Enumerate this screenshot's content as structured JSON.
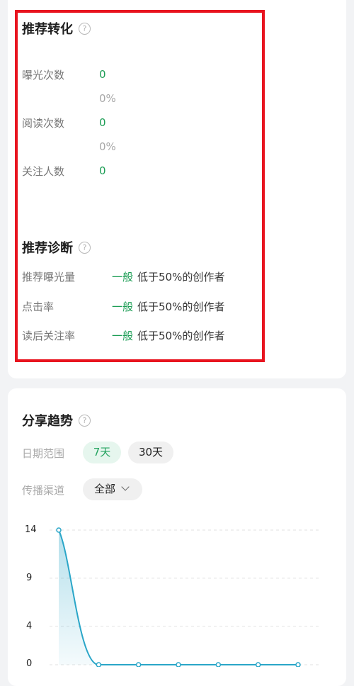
{
  "recommend_conversion": {
    "title": "推荐转化",
    "help_icon": "question-circle-icon",
    "metrics": [
      {
        "label": "曝光次数",
        "value": "0",
        "percent": "0%"
      },
      {
        "label": "阅读次数",
        "value": "0",
        "percent": "0%"
      },
      {
        "label": "关注人数",
        "value": "0"
      }
    ]
  },
  "recommend_diagnosis": {
    "title": "推荐诊断",
    "help_icon": "question-circle-icon",
    "items": [
      {
        "label": "推荐曝光量",
        "level": "一般",
        "note": "低于50%的创作者"
      },
      {
        "label": "点击率",
        "level": "一般",
        "note": "低于50%的创作者"
      },
      {
        "label": "读后关注率",
        "level": "一般",
        "note": "低于50%的创作者"
      }
    ]
  },
  "share_trend": {
    "title": "分享趋势",
    "help_icon": "question-circle-icon",
    "date_range_label": "日期范围",
    "date_options": [
      "7天",
      "30天"
    ],
    "date_selected": "7天",
    "channel_label": "传播渠道",
    "channel_value": "全部",
    "channel_icon": "chevron-down-icon"
  },
  "colors": {
    "accent_green": "#1e9e56",
    "highlight_red": "#e8141f",
    "line_blue": "#2aa6c8"
  },
  "chart_data": {
    "type": "area",
    "y_ticks": [
      "14",
      "9",
      "4",
      "0"
    ],
    "ylim": [
      0,
      14
    ],
    "x": [
      1,
      2,
      3,
      4,
      5,
      6,
      7
    ],
    "values": [
      14,
      0,
      0,
      0,
      0,
      0,
      0
    ],
    "grid": true,
    "xlabel": "",
    "ylabel": ""
  }
}
